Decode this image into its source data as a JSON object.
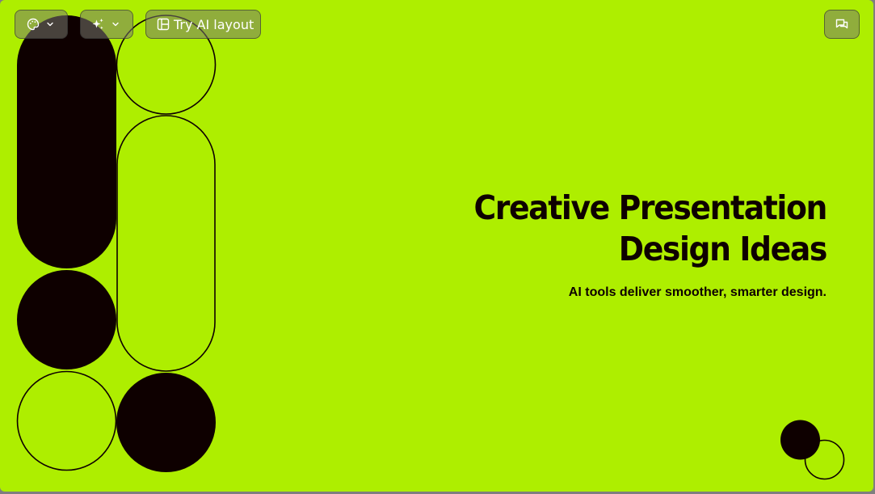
{
  "toolbar": {
    "theme_icon": "palette-icon",
    "ai_icon": "sparkle-icon",
    "layout_label": "Try AI layout",
    "layout_icon": "layout-icon",
    "comment_icon": "comment-icon"
  },
  "slide": {
    "title_line1": "Creative Presentation",
    "title_line2": "Design Ideas",
    "subtitle": "AI tools deliver smoother, smarter design."
  },
  "colors": {
    "background": "#aeee00",
    "ink": "#0e0000"
  }
}
